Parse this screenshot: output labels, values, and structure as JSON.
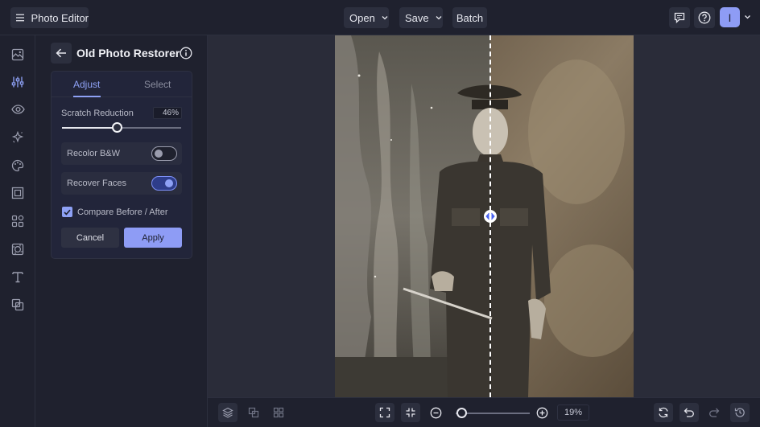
{
  "topbar": {
    "app_title": "Photo Editor",
    "open_label": "Open",
    "save_label": "Save",
    "batch_label": "Batch",
    "avatar_initial": "I"
  },
  "rail": {
    "items": [
      "image-icon",
      "sliders-icon",
      "eye-icon",
      "sparkle-icon",
      "palette-icon",
      "frame-icon",
      "shapes-icon",
      "texture-icon",
      "text-icon",
      "overlay-icon"
    ],
    "active_index": 1
  },
  "panel": {
    "title": "Old Photo Restorer",
    "tabs": [
      {
        "label": "Adjust",
        "active": true
      },
      {
        "label": "Select",
        "active": false
      }
    ],
    "scratch_label": "Scratch Reduction",
    "scratch_value": "46%",
    "scratch_level": 0.46,
    "recolor_label": "Recolor B&W",
    "recolor_on": false,
    "recover_label": "Recover Faces",
    "recover_on": true,
    "compare_label": "Compare Before / After",
    "compare_checked": true,
    "cancel_label": "Cancel",
    "apply_label": "Apply"
  },
  "canvas": {
    "compare_split": 0.52
  },
  "bottombar": {
    "zoom_value": "19%",
    "zoom_level": 0.08
  },
  "colors": {
    "accent": "#8e9cf5",
    "background": "#1f212e",
    "surface": "#2c2f3e"
  }
}
